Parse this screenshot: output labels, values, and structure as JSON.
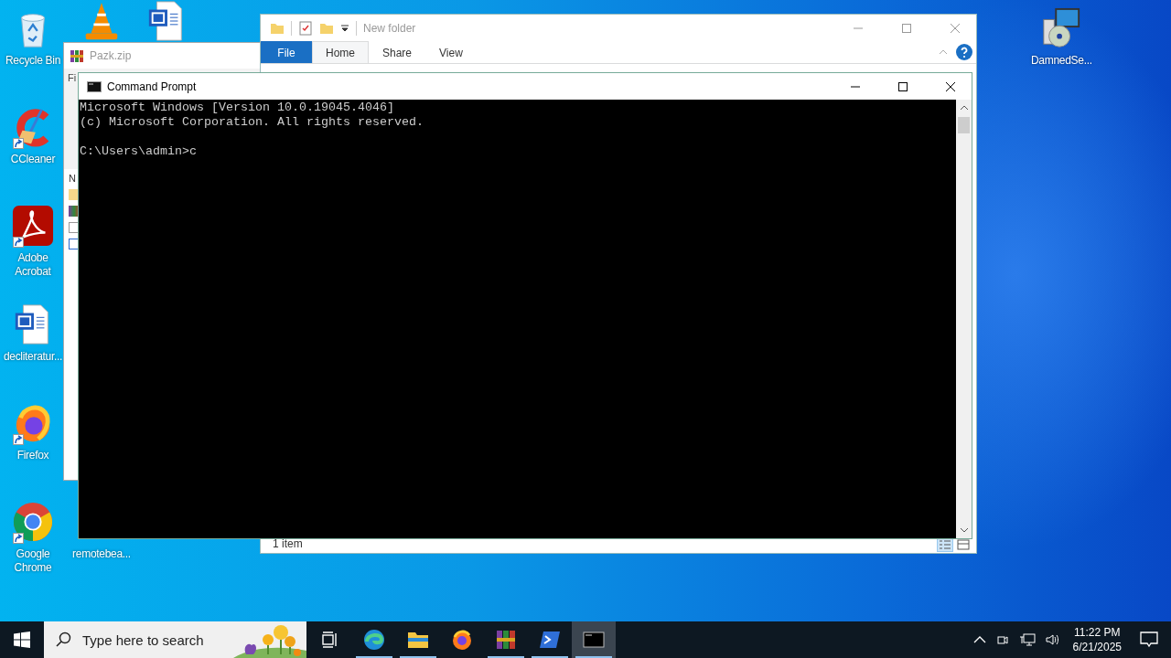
{
  "desktop_icons": [
    {
      "label": "Recycle Bin",
      "kind": "recycle-bin"
    },
    {
      "label": "CCleaner",
      "kind": "ccleaner",
      "shortcut": true
    },
    {
      "label": "Adobe Acrobat",
      "kind": "acrobat",
      "shortcut": true
    },
    {
      "label": "decliteratur...",
      "kind": "word-doc"
    },
    {
      "label": "Firefox",
      "kind": "firefox",
      "shortcut": true
    },
    {
      "label": "Google Chrome",
      "kind": "chrome",
      "shortcut": true
    },
    {
      "kind": "vlc"
    },
    {
      "kind": "word-doc"
    },
    {
      "label": "remotebea..."
    },
    {
      "label": "DamnedSe...",
      "kind": "installer"
    }
  ],
  "archive_window": {
    "title": "Pazk.zip",
    "menu_fragment": "Fi",
    "column_fragment": "N"
  },
  "explorer_window": {
    "title": "New folder",
    "tabs": [
      {
        "label": "File",
        "kind": "backstage",
        "selected": false
      },
      {
        "label": "Home",
        "kind": "tab",
        "selected": true
      },
      {
        "label": "Share",
        "kind": "tab",
        "selected": false
      },
      {
        "label": "View",
        "kind": "tab",
        "selected": false
      }
    ],
    "status": "1 item"
  },
  "console_window": {
    "title": "Command Prompt",
    "output": [
      "Microsoft Windows [Version 10.0.19045.4046]",
      "(c) Microsoft Corporation. All rights reserved."
    ],
    "prompt": "C:\\Users\\admin>c"
  },
  "taskbar": {
    "search": {
      "placeholder": "Type here to search"
    },
    "apps": [
      {
        "kind": "edge",
        "running": true,
        "active": false
      },
      {
        "kind": "explorer",
        "running": true,
        "active": false
      },
      {
        "kind": "firefox",
        "running": false,
        "active": false
      },
      {
        "kind": "winrar",
        "running": true,
        "active": false
      },
      {
        "kind": "powershell",
        "running": true,
        "active": false
      },
      {
        "kind": "cmd",
        "running": true,
        "active": true
      }
    ],
    "time": "11:22 PM",
    "date": "6/21/2025"
  }
}
